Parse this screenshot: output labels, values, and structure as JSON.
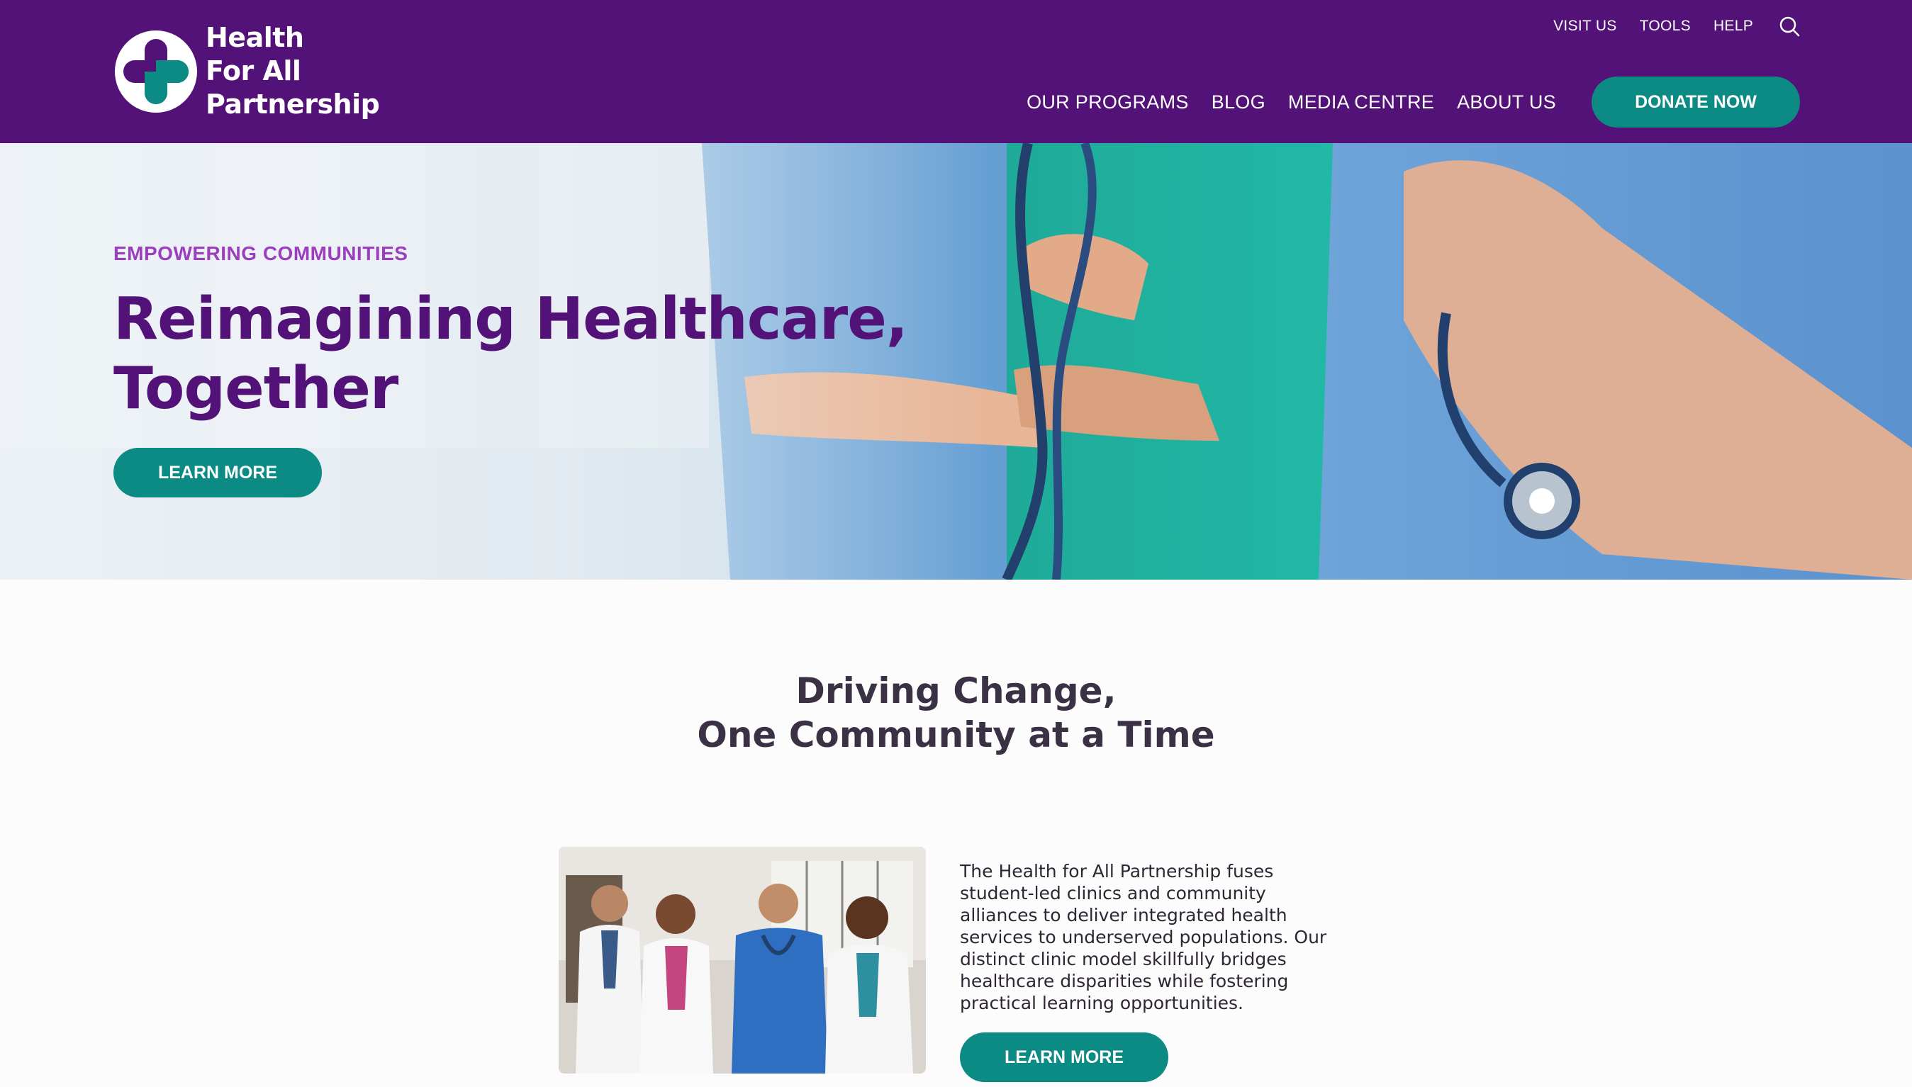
{
  "brand": {
    "lines": [
      "Health",
      "For All",
      "Partnership"
    ],
    "primary_color": "#521277",
    "accent_color": "#0b8b84",
    "logo_icon": "medical-cross-icon"
  },
  "utility_nav": {
    "items": [
      "VISIT US",
      "TOOLS",
      "HELP"
    ],
    "search_icon": "search-icon"
  },
  "main_nav": {
    "items": [
      "OUR PROGRAMS",
      "BLOG",
      "MEDIA CENTRE",
      "ABOUT US"
    ],
    "donate_label": "DONATE NOW"
  },
  "hero": {
    "eyebrow": "EMPOWERING COMMUNITIES",
    "title_line1": "Reimagining Healthcare,",
    "title_line2": "Together",
    "button_label": "LEARN MORE"
  },
  "intro": {
    "title_line1": "Driving Change,",
    "title_line2": "One Community at a Time",
    "body_lines": [
      "The Health for All Partnership fuses",
      "student-led clinics and community",
      "alliances to deliver integrated health",
      "services to underserved populations. Our",
      "distinct clinic model skillfully bridges",
      "healthcare disparities while fostering",
      "practical learning opportunities."
    ],
    "button_label": "LEARN MORE"
  }
}
